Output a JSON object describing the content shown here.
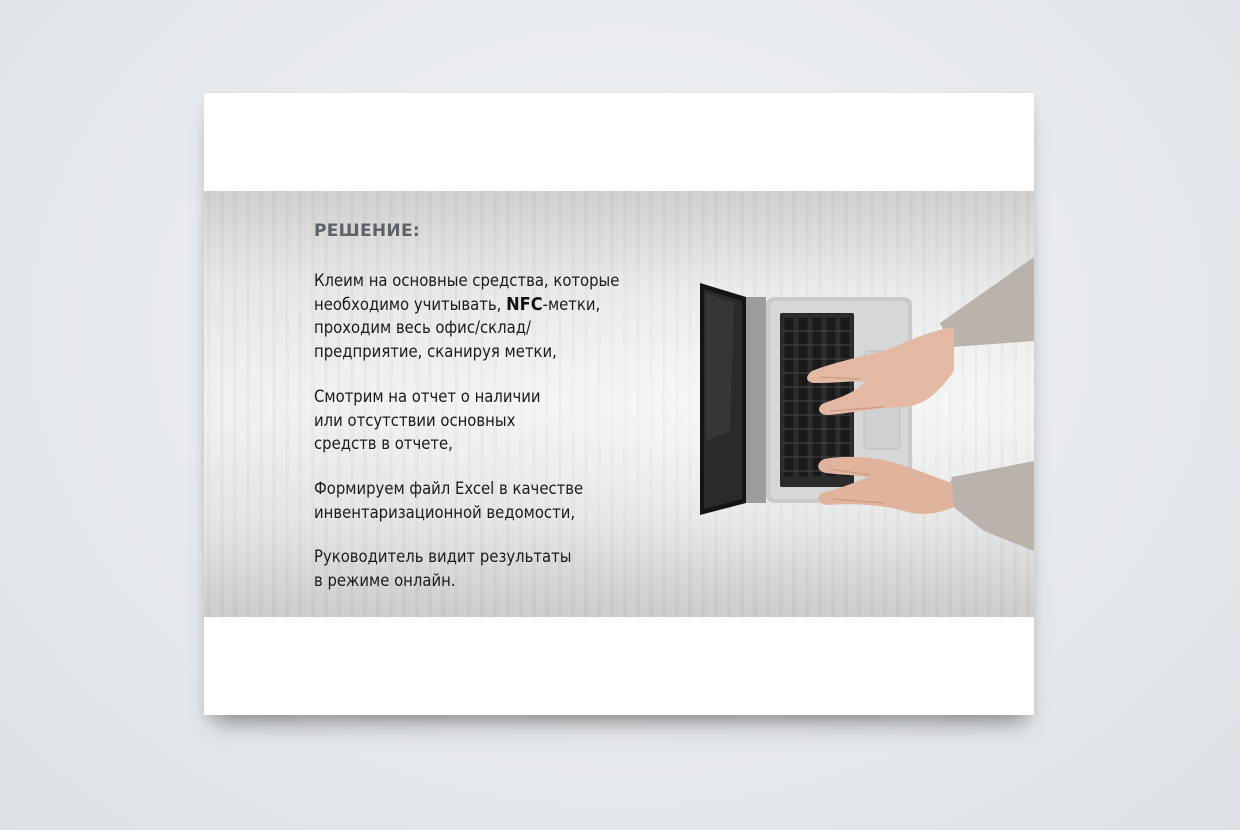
{
  "slide": {
    "heading": "РЕШЕНИЕ:",
    "paragraph1": {
      "before": "Клеим на основные средства, которые\nнеобходимо учитывать, ",
      "highlight": "NFC",
      "after": "-метки,\nпроходим весь офис/склад/\nпредприятие, сканируя метки,"
    },
    "paragraph2": "Смотрим на отчет о наличии\nили отсутствии основных\nсредств в отчете,",
    "paragraph3": "Формируем файл Excel в качестве\nинвентаризационной ведомости,",
    "paragraph4": "Руководитель видит результаты\nв режиме онлайн."
  },
  "colors": {
    "heading": "#5d6168",
    "body_text": "#1b1b1b",
    "card": "#ffffff",
    "background": "#e6e9ec"
  },
  "image": {
    "icon": "laptop-typing-photo"
  }
}
